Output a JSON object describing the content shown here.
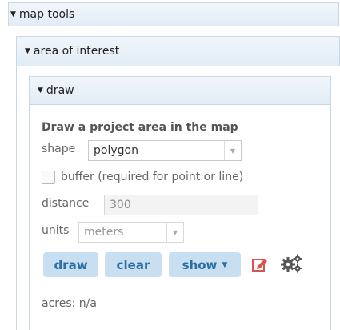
{
  "map_tools": {
    "label": "map tools"
  },
  "area_of_interest": {
    "label": "area of interest"
  },
  "draw_panel": {
    "label": "draw",
    "title": "Draw a project area in the map",
    "shape": {
      "label": "shape",
      "value": "polygon"
    },
    "buffer": {
      "label": "buffer (required for point or line)",
      "checked": false
    },
    "distance": {
      "label": "distance",
      "value": "300"
    },
    "units": {
      "label": "units",
      "value": "meters"
    },
    "buttons": {
      "draw": "draw",
      "clear": "clear",
      "show": "show"
    },
    "acres": "acres: n/a",
    "icons": [
      "edit-icon",
      "gears-icon"
    ]
  },
  "colors": {
    "accent": "#2b6fa4",
    "button_bg": "#c8dff1",
    "header_bg": "#e2ecf6",
    "edit_icon": "#d9534f"
  }
}
